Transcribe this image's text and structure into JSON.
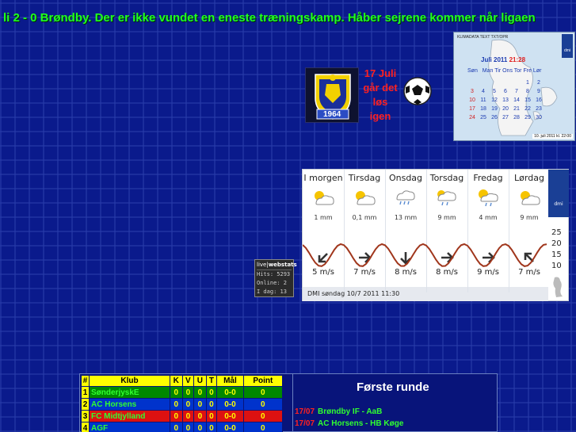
{
  "ticker": {
    "text": "li 2 - 0 Brøndby. Der er ikke vundet en eneste træningskamp. Håber sejrene kommer når ligaen"
  },
  "banner": {
    "crest_year": "1964",
    "line1": "17 Juli",
    "line2": "går det",
    "line3": "løs",
    "line4": "igen"
  },
  "calendar": {
    "note": "KLIMADATA TEXT TXT/OPR",
    "month": "Juli 2011",
    "clock": "21:28",
    "weekdays": [
      "Søn",
      "Man",
      "Tir",
      "Ons",
      "Tor",
      "Fre",
      "Lør"
    ],
    "rows": [
      [
        "",
        "",
        "",
        "",
        "",
        "1",
        "2"
      ],
      [
        "3",
        "4",
        "5",
        "6",
        "7",
        "8",
        "9"
      ],
      [
        "10",
        "11",
        "12",
        "13",
        "14",
        "15",
        "16"
      ],
      [
        "17",
        "18",
        "19",
        "20",
        "21",
        "22",
        "23"
      ],
      [
        "24",
        "25",
        "26",
        "27",
        "28",
        "29",
        "30"
      ]
    ],
    "stamp": "10. juli 2011 kl. 22:00",
    "logo": "dmi"
  },
  "weather": {
    "days": [
      {
        "name": "I morgen",
        "precip": "1 mm",
        "wind": "5 m/s",
        "icon": "sun-cloud-icon",
        "arrow": "arrow-down-left-icon"
      },
      {
        "name": "Tirsdag",
        "precip": "0,1 mm",
        "wind": "7 m/s",
        "icon": "sun-cloud-icon",
        "arrow": "arrow-right-icon"
      },
      {
        "name": "Onsdag",
        "precip": "13 mm",
        "wind": "8 m/s",
        "icon": "rain-cloud-icon",
        "arrow": "arrow-down-icon"
      },
      {
        "name": "Torsdag",
        "precip": "9 mm",
        "wind": "8 m/s",
        "icon": "rain-cloud-sun-icon",
        "arrow": "arrow-right-icon"
      },
      {
        "name": "Fredag",
        "precip": "4 mm",
        "wind": "9 m/s",
        "icon": "sun-cloud-rain-icon",
        "arrow": "arrow-right-icon"
      },
      {
        "name": "Lørdag",
        "precip": "9 mm",
        "wind": "7 m/s",
        "icon": "sun-cloud-icon",
        "arrow": "arrow-up-left-icon"
      }
    ],
    "temp_axis": [
      "25",
      "20",
      "15",
      "10"
    ],
    "footer": "DMI søndag 10/7 2011  11:30",
    "logo": "dmi",
    "line_color": "#a0361c"
  },
  "webstats": {
    "title_a": "live",
    "title_b": "webstats",
    "hits": "Hits: 5293",
    "online": "Online: 2",
    "today": "I dag: 13"
  },
  "league": {
    "headers": [
      "#",
      "Klub",
      "K",
      "V",
      "U",
      "T",
      "Mål",
      "Point"
    ],
    "rows": [
      {
        "pos": "1",
        "club": "SønderjyskE",
        "k": "0",
        "v": "0",
        "u": "0",
        "t": "0",
        "goals": "0-0",
        "points": "0",
        "color": "green"
      },
      {
        "pos": "2",
        "club": "AC Horsens",
        "k": "0",
        "v": "0",
        "u": "0",
        "t": "0",
        "goals": "0-0",
        "points": "0",
        "color": "blue"
      },
      {
        "pos": "3",
        "club": "FC Midtjylland",
        "k": "0",
        "v": "0",
        "u": "0",
        "t": "0",
        "goals": "0-0",
        "points": "0",
        "color": "red"
      },
      {
        "pos": "4",
        "club": "AGF",
        "k": "0",
        "v": "0",
        "u": "0",
        "t": "0",
        "goals": "0-0",
        "points": "0",
        "color": "blue"
      }
    ],
    "round_title": "Første runde",
    "fixtures": [
      {
        "date": "17/07",
        "match": "Brøndby IF - AaB"
      },
      {
        "date": "17/07",
        "match": "AC Horsens - HB Køge"
      }
    ]
  },
  "colors": {
    "background": "#0a1a8c",
    "ticker": "#20ff20",
    "banner_text": "#ff2020"
  }
}
